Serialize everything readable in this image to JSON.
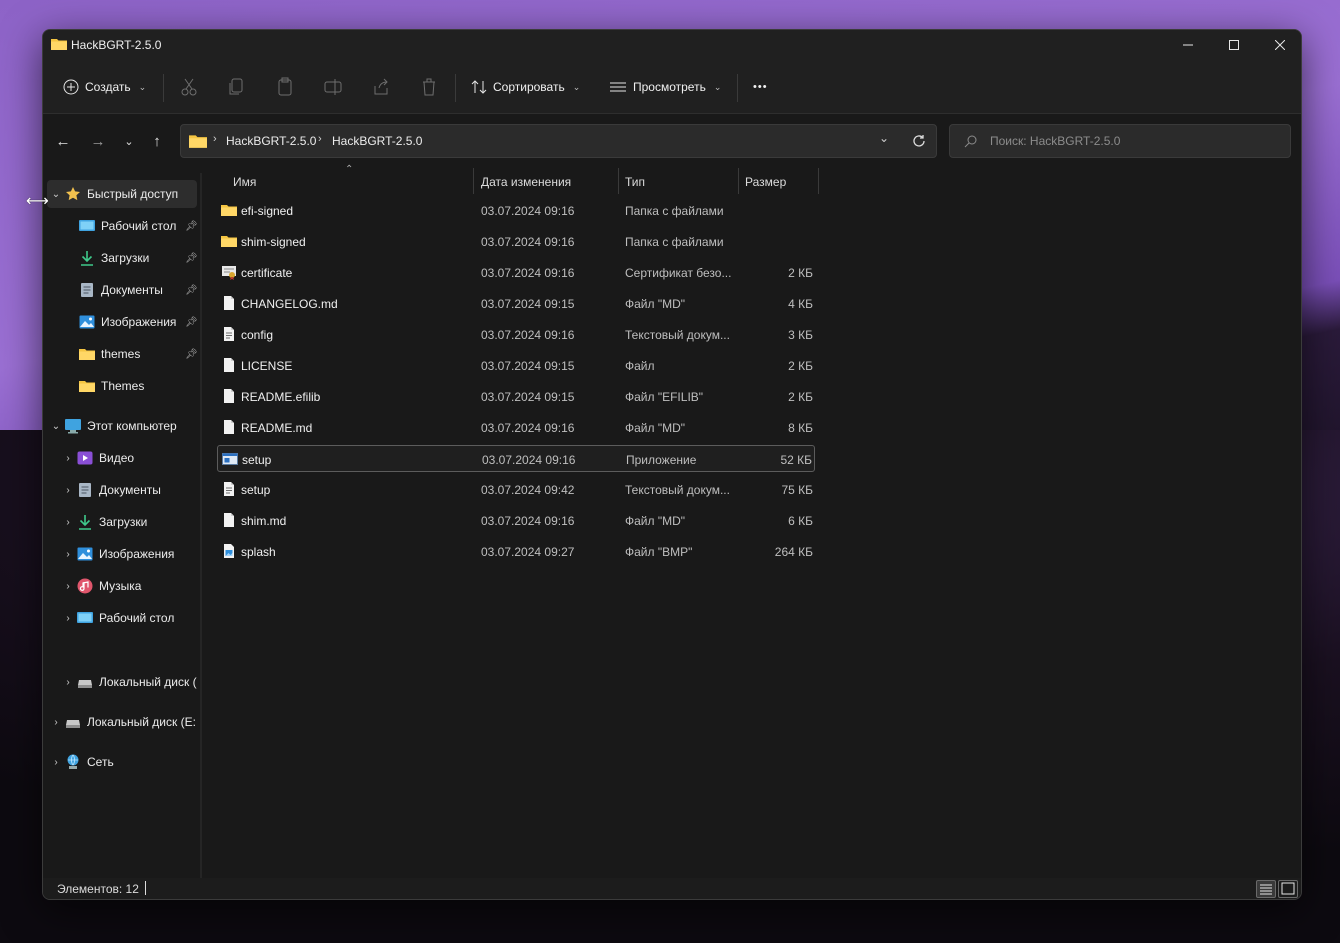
{
  "window": {
    "title": "HackBGRT-2.5.0"
  },
  "toolbar": {
    "create_label": "Создать",
    "sort_label": "Сортировать",
    "view_label": "Просмотреть",
    "more_label": "•••"
  },
  "address": {
    "crumbs": [
      "HackBGRT-2.5.0",
      "HackBGRT-2.5.0"
    ],
    "crumb_separator": "›"
  },
  "search": {
    "placeholder": "Поиск: HackBGRT-2.5.0"
  },
  "sidebar": {
    "quick_access": {
      "label": "Быстрый доступ",
      "items": [
        {
          "label": "Рабочий стол",
          "icon": "desktop-icon",
          "pinned": true
        },
        {
          "label": "Загрузки",
          "icon": "download-icon",
          "pinned": true
        },
        {
          "label": "Документы",
          "icon": "documents-icon",
          "pinned": true
        },
        {
          "label": "Изображения",
          "icon": "pictures-icon",
          "pinned": true
        },
        {
          "label": "themes",
          "icon": "folder-icon",
          "pinned": true
        },
        {
          "label": "Themes",
          "icon": "folder-icon",
          "pinned": false
        }
      ]
    },
    "this_pc": {
      "label": "Этот компьютер",
      "items": [
        {
          "label": "Видео",
          "icon": "video-icon"
        },
        {
          "label": "Документы",
          "icon": "documents-icon"
        },
        {
          "label": "Загрузки",
          "icon": "download-icon"
        },
        {
          "label": "Изображения",
          "icon": "pictures-icon"
        },
        {
          "label": "Музыка",
          "icon": "music-icon"
        },
        {
          "label": "Рабочий стол",
          "icon": "desktop-icon"
        }
      ]
    },
    "local_disk_c": "Локальный диск (",
    "local_disk_e": "Локальный диск (E:",
    "network": "Сеть"
  },
  "columns": {
    "name": "Имя",
    "date": "Дата изменения",
    "type": "Тип",
    "size": "Размер"
  },
  "files": [
    {
      "name": "efi-signed",
      "date": "03.07.2024 09:16",
      "type": "Папка с файлами",
      "size": "",
      "icon": "folder-icon"
    },
    {
      "name": "shim-signed",
      "date": "03.07.2024 09:16",
      "type": "Папка с файлами",
      "size": "",
      "icon": "folder-icon"
    },
    {
      "name": "certificate",
      "date": "03.07.2024 09:16",
      "type": "Сертификат безо...",
      "size": "2 КБ",
      "icon": "certificate-icon"
    },
    {
      "name": "CHANGELOG.md",
      "date": "03.07.2024 09:15",
      "type": "Файл \"MD\"",
      "size": "4 КБ",
      "icon": "file-icon"
    },
    {
      "name": "config",
      "date": "03.07.2024 09:16",
      "type": "Текстовый докум...",
      "size": "3 КБ",
      "icon": "text-file-icon"
    },
    {
      "name": "LICENSE",
      "date": "03.07.2024 09:15",
      "type": "Файл",
      "size": "2 КБ",
      "icon": "file-icon"
    },
    {
      "name": "README.efilib",
      "date": "03.07.2024 09:15",
      "type": "Файл \"EFILIB\"",
      "size": "2 КБ",
      "icon": "file-icon"
    },
    {
      "name": "README.md",
      "date": "03.07.2024 09:16",
      "type": "Файл \"MD\"",
      "size": "8 КБ",
      "icon": "file-icon"
    },
    {
      "name": "setup",
      "date": "03.07.2024 09:16",
      "type": "Приложение",
      "size": "52 КБ",
      "icon": "app-icon",
      "selected": true
    },
    {
      "name": "setup",
      "date": "03.07.2024 09:42",
      "type": "Текстовый докум...",
      "size": "75 КБ",
      "icon": "text-file-icon"
    },
    {
      "name": "shim.md",
      "date": "03.07.2024 09:16",
      "type": "Файл \"MD\"",
      "size": "6 КБ",
      "icon": "file-icon"
    },
    {
      "name": "splash",
      "date": "03.07.2024 09:27",
      "type": "Файл \"BMP\"",
      "size": "264 КБ",
      "icon": "image-file-icon"
    }
  ],
  "status": {
    "items_text": "Элементов: 12"
  },
  "colors": {
    "folder": "#f5c542",
    "accent": "#4aa3df",
    "star": "#f2c14e"
  }
}
